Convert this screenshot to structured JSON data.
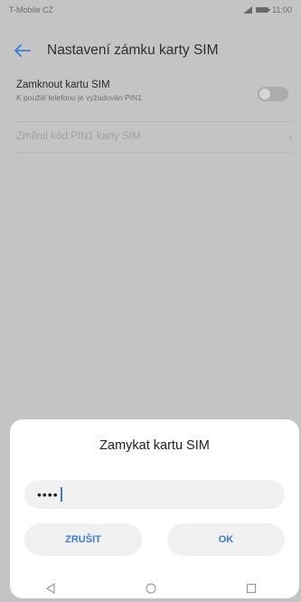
{
  "status_bar": {
    "carrier": "T-Mobile CZ",
    "time": "11:00"
  },
  "app_bar": {
    "title": "Nastavení zámku karty SIM"
  },
  "settings": {
    "lock": {
      "title": "Zamknout kartu SIM",
      "subtitle": "K použití telefonu je vyžadován PIN1",
      "enabled": false
    },
    "change_pin": {
      "label": "Změnit kód PIN1 karty SIM"
    }
  },
  "dialog": {
    "title": "Zamykat kartu SIM",
    "pin_value": "••••",
    "cancel_label": "ZRUŠIT",
    "ok_label": "OK"
  },
  "colors": {
    "accent": "#3d7bd6",
    "scrim_bg": "#c4c4c4",
    "dialog_bg": "#ffffff"
  }
}
